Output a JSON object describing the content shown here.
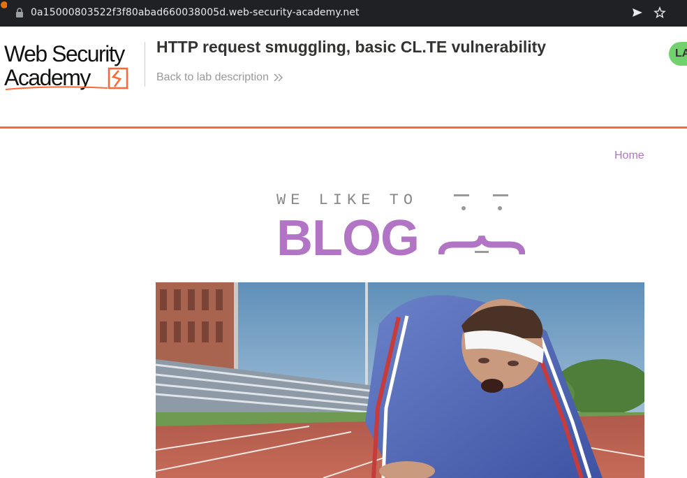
{
  "browser": {
    "url": "0a15000803522f3f80abad660038005d.web-security-academy.net",
    "icons": [
      "lock-icon",
      "send-icon",
      "star-icon",
      "extension-icon"
    ]
  },
  "lab": {
    "logo_line1": "Web Security",
    "logo_line2": "Academy",
    "title": "HTTP request smuggling, basic CL.TE vulnerability",
    "back_link": "Back to lab description",
    "status_badge": "LA",
    "accent_color": "#ff6633",
    "status_color": "#70d16d"
  },
  "nav": {
    "home": "Home",
    "link_color": "#b274c5"
  },
  "blog_banner": {
    "tagline": "WE LIKE TO",
    "word": "BLOG"
  }
}
